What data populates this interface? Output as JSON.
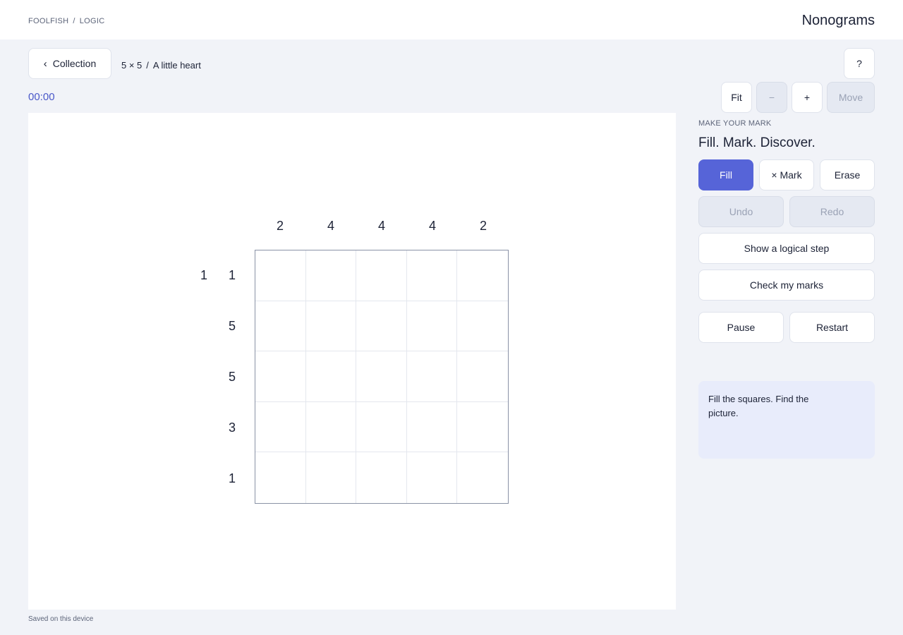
{
  "header": {
    "crumb_1": "FOOLFISH",
    "crumb_sep": "/",
    "crumb_2": "LOGIC",
    "title": "Nonograms"
  },
  "toolbar": {
    "back_chevron": "‹",
    "back_label": "Collection",
    "size": "5 × 5",
    "meta_sep": "/",
    "puzzle_name": "A little heart",
    "help_label": "?",
    "timer": "00:00",
    "fit_label": "Fit",
    "zoom_out_label": "−",
    "zoom_in_label": "+",
    "move_label": "Move"
  },
  "board": {
    "column_clues": [
      "2",
      "4",
      "4",
      "4",
      "2"
    ],
    "row_clues": [
      [
        "1",
        "1"
      ],
      [
        "5"
      ],
      [
        "5"
      ],
      [
        "3"
      ],
      [
        "1"
      ]
    ],
    "rows": 5,
    "cols": 5
  },
  "side": {
    "eyebrow": "MAKE YOUR MARK",
    "title": "Fill. Mark. Discover.",
    "fill_label": "Fill",
    "mark_label": "× Mark",
    "erase_label": "Erase",
    "undo_label": "Undo",
    "redo_label": "Redo",
    "step_label": "Show a logical step",
    "check_label": "Check my marks",
    "pause_label": "Pause",
    "restart_label": "Restart",
    "hint": "Fill the squares. Find the picture."
  },
  "footer": {
    "saved": "Saved on this device"
  },
  "colors": {
    "accent": "#5664d8",
    "timer": "#4a58c9",
    "hint_bg": "#e8ecfb",
    "disabled_bg": "#e5e9f2"
  }
}
